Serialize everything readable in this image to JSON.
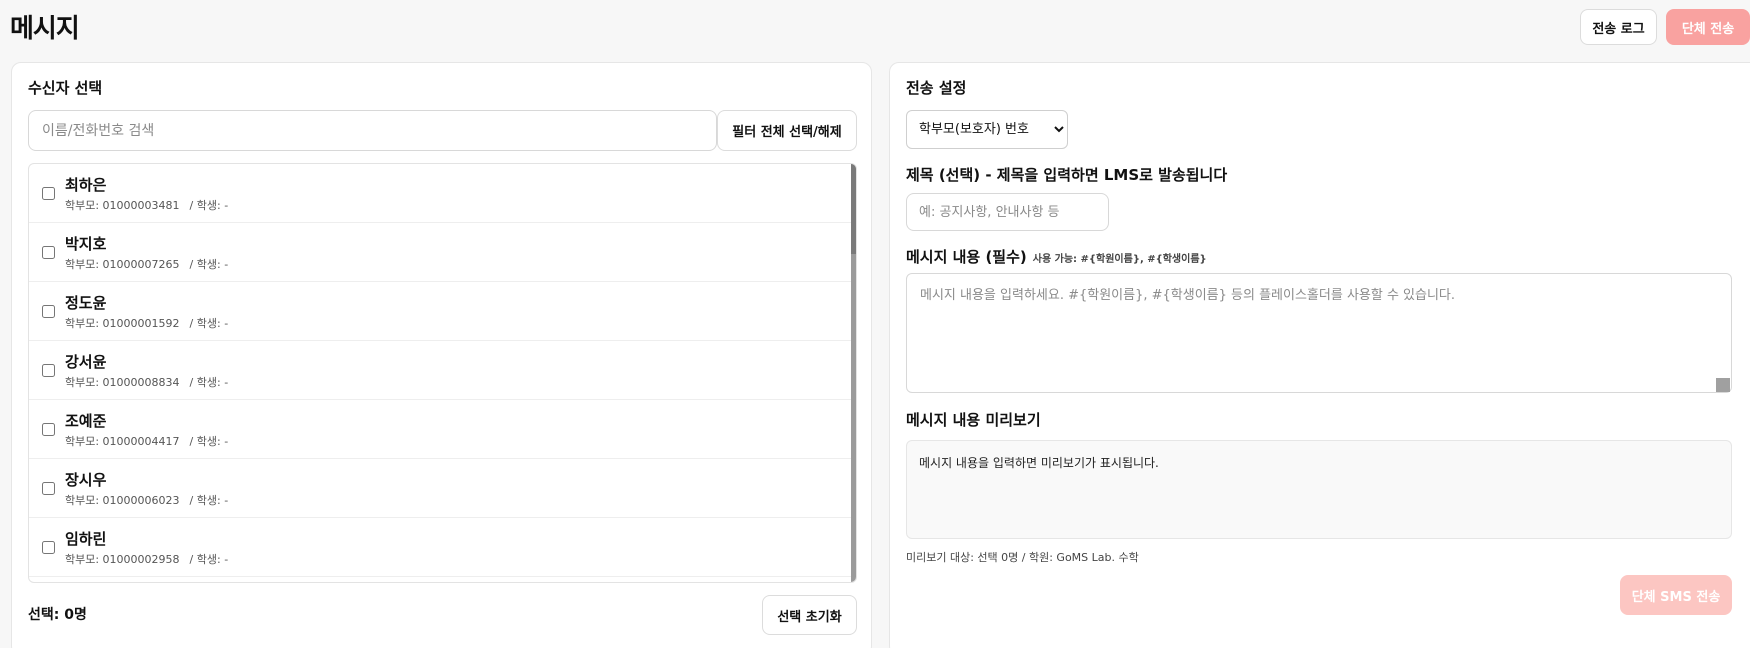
{
  "header": {
    "title": "메시지",
    "log_button": "전송 로그",
    "bulk_button": "단체 전송"
  },
  "recipients": {
    "section_title": "수신자 선택",
    "search_placeholder": "이름/전화번호 검색",
    "filter_button": "필터 전체 선택/해제",
    "items": [
      {
        "name": "최하은",
        "parent": "학부모: 01000003481",
        "student": "/ 학생: -"
      },
      {
        "name": "박지호",
        "parent": "학부모: 01000007265",
        "student": "/ 학생: -"
      },
      {
        "name": "정도윤",
        "parent": "학부모: 01000001592",
        "student": "/ 학생: -"
      },
      {
        "name": "강서윤",
        "parent": "학부모: 01000008834",
        "student": "/ 학생: -"
      },
      {
        "name": "조예준",
        "parent": "학부모: 01000004417",
        "student": "/ 학생: -"
      },
      {
        "name": "장시우",
        "parent": "학부모: 01000006023",
        "student": "/ 학생: -"
      },
      {
        "name": "임하린",
        "parent": "학부모: 01000002958",
        "student": "/ 학생: -"
      }
    ],
    "selected_count": "선택: 0명",
    "reset_button": "선택 초기화"
  },
  "settings": {
    "section_title": "전송 설정",
    "target_selected": "학부모(보호자) 번호",
    "title_label": "제목 (선택) - 제목을 입력하면 LMS로 발송됩니다",
    "title_placeholder": "예: 공지사항, 안내사항 등",
    "content_label": "메시지 내용 (필수)",
    "content_hint": "사용 가능: #{학원이름}, #{학생이름}",
    "content_placeholder": "메시지 내용을 입력하세요. #{학원이름}, #{학생이름} 등의 플레이스홀더를 사용할 수 있습니다.",
    "preview_label": "메시지 내용 미리보기",
    "preview_text": "메시지 내용을 입력하면 미리보기가 표시됩니다.",
    "preview_meta": "미리보기 대상: 선택 0명 / 학원: GoMS Lab. 수학",
    "send_button": "단체 SMS 전송"
  },
  "colors": {
    "bulk_button": "#f9a2a0",
    "send_button_disabled": "#fcc6c2"
  }
}
